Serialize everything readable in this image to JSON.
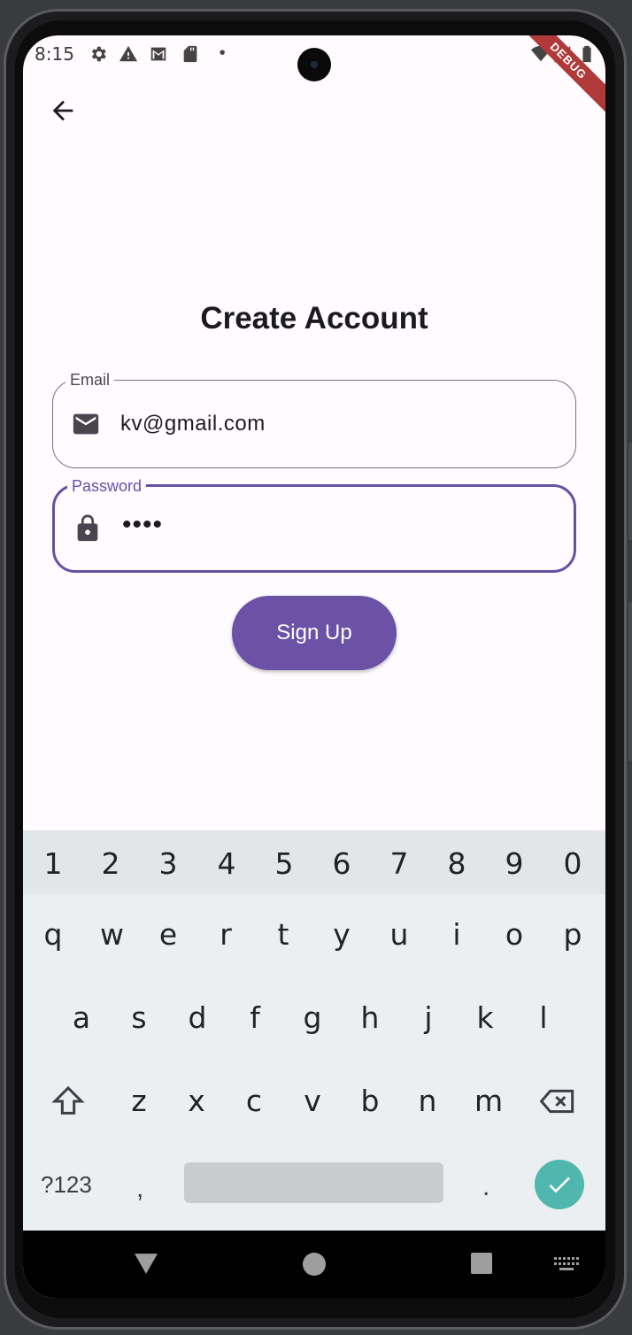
{
  "status_bar": {
    "time": "8:15",
    "icons": [
      "gear-icon",
      "warning-icon",
      "gmail-icon",
      "sd-card-icon",
      "dot-icon",
      "wifi-icon",
      "signal-icon",
      "battery-icon"
    ],
    "debug_banner": "DEBUG"
  },
  "app_bar": {
    "back_icon": "arrow-back-icon"
  },
  "page": {
    "title": "Create Account",
    "email": {
      "label": "Email",
      "value": "kv@gmail.com",
      "icon": "mail-icon"
    },
    "password": {
      "label": "Password",
      "value": "••••",
      "icon": "lock-icon",
      "focused": true
    },
    "signup_label": "Sign Up"
  },
  "colors": {
    "primary": "#6750a4",
    "button": "#6b52a6",
    "background": "#fffbfe",
    "keyboard": "#eceff1",
    "enter_key": "#4fb7ad"
  },
  "keyboard": {
    "number_row": [
      "1",
      "2",
      "3",
      "4",
      "5",
      "6",
      "7",
      "8",
      "9",
      "0"
    ],
    "row1": [
      "q",
      "w",
      "e",
      "r",
      "t",
      "y",
      "u",
      "i",
      "o",
      "p"
    ],
    "row2": [
      "a",
      "s",
      "d",
      "f",
      "g",
      "h",
      "j",
      "k",
      "l"
    ],
    "row3": [
      "z",
      "x",
      "c",
      "v",
      "b",
      "n",
      "m"
    ],
    "symbols_label": "?123",
    "comma": ",",
    "period": "."
  },
  "nav_bar": {
    "icons": [
      "back-triangle-icon",
      "home-circle-icon",
      "recents-square-icon",
      "keyboard-switch-icon"
    ]
  }
}
